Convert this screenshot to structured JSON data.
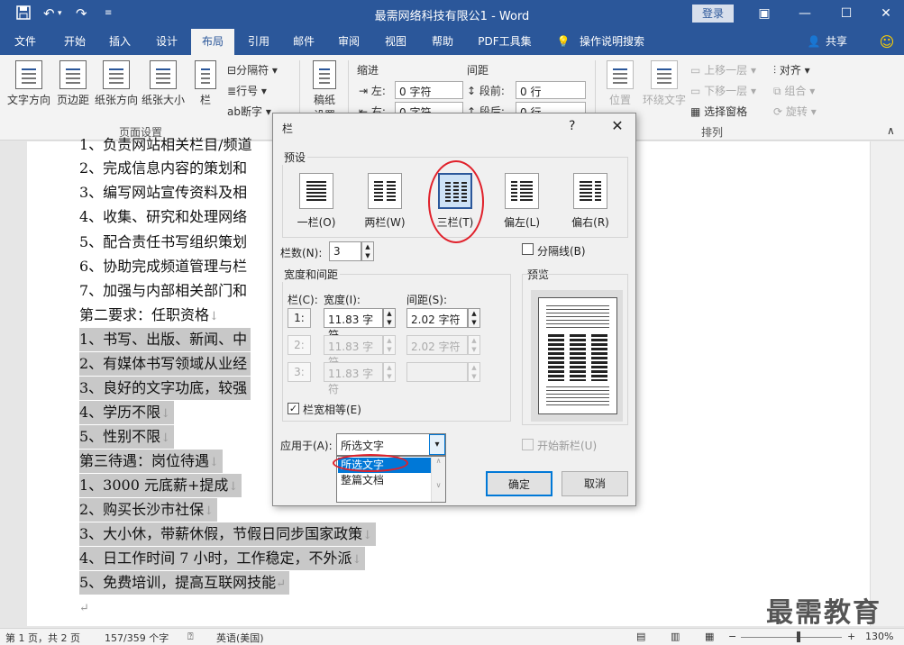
{
  "app": {
    "title": "最需网络科技有限公1  -  Word",
    "login": "登录",
    "share": "共享",
    "colors": {
      "brand": "#2b579a",
      "selection": "#c8c8c8",
      "highlight": "#0078d7",
      "annotation": "#e0202a"
    }
  },
  "quick_access": [
    "save-icon",
    "undo-icon",
    "redo-icon",
    "customize-icon"
  ],
  "window_controls": [
    "ribbon-display-icon",
    "minimize-icon",
    "maximize-icon",
    "close-icon"
  ],
  "tabs": [
    "文件",
    "开始",
    "插入",
    "设计",
    "布局",
    "引用",
    "邮件",
    "审阅",
    "视图",
    "帮助",
    "PDF工具集",
    "操作说明搜索"
  ],
  "active_tab": "布局",
  "ribbon": {
    "page_setup": {
      "big_buttons": [
        "文字方向",
        "页边距",
        "纸张方向",
        "纸张大小",
        "栏"
      ],
      "small_buttons": [
        "分隔符",
        "行号",
        "断字"
      ],
      "group_label": "页面设置"
    },
    "manuscript": "稿纸设置",
    "indent": {
      "label": "缩进",
      "left_label": "左:",
      "left_value": "0 字符",
      "right_label": "右:",
      "right_value": "0 字符"
    },
    "spacing": {
      "label": "间距",
      "before_label": "段前:",
      "before_value": "0 行",
      "after_label": "段后:",
      "after_value": "0 行"
    },
    "arrange": {
      "position": "位置",
      "wrap": "环绕文字",
      "bring_forward": "上移一层",
      "send_backward": "下移一层",
      "selection_pane": "选择窗格",
      "align": "对齐",
      "group": "组合",
      "rotate": "旋转",
      "group_label": "排列"
    }
  },
  "document": {
    "lines": [
      "1、负责网站相关栏目/频道",
      "2、完成信息内容的策划和",
      "3、编写网站宣传资料及相",
      "4、收集、研究和处理网络",
      "5、配合责任书写组织策划",
      "6、协助完成频道管理与栏",
      "7、加强与内部相关部门和",
      "第二要求：任职资格",
      "1、书写、出版、新闻、中",
      "2、有媒体书写领域从业经",
      "3、良好的文字功底，较强",
      "4、学历不限",
      "5、性别不限",
      "第三待遇：岗位待遇",
      "1、3000 元底薪+提成",
      "2、购买长沙市社保",
      "3、大小休，带薪休假，节假日同步国家政策",
      "4、日工作时间 7 小时，工作稳定，不外派",
      "5、免费培训，提高互联网技能"
    ],
    "watermark": "最需教育"
  },
  "status": {
    "page": "第 1 页，共 2 页",
    "words": "157/359 个字",
    "language": "英语(美国)",
    "zoom": "130%"
  },
  "dialog": {
    "title": "栏",
    "help": "?",
    "presets_label": "预设",
    "presets": [
      "一栏(O)",
      "两栏(W)",
      "三栏(T)",
      "偏左(L)",
      "偏右(R)"
    ],
    "selected_preset": "三栏(T)",
    "num_cols_label": "栏数(N):",
    "num_cols_value": "3",
    "line_between_label": "分隔线(B)",
    "width_spacing_label": "宽度和间距",
    "col_header": "栏(C):",
    "width_header": "宽度(I):",
    "spacing_header": "间距(S):",
    "rows": [
      {
        "num": "1:",
        "width": "11.83 字符",
        "spacing": "2.02 字符"
      },
      {
        "num": "2:",
        "width": "11.83 字符",
        "spacing": "2.02 字符"
      },
      {
        "num": "3:",
        "width": "11.83 字符",
        "spacing": ""
      }
    ],
    "equal_width_label": "栏宽相等(E)",
    "equal_width_checked": true,
    "preview_label": "预览",
    "apply_label": "应用于(A):",
    "apply_value": "所选文字",
    "apply_options": [
      "所选文字",
      "整篇文档"
    ],
    "new_col_label": "开始新栏(U)",
    "ok": "确定",
    "cancel": "取消"
  }
}
